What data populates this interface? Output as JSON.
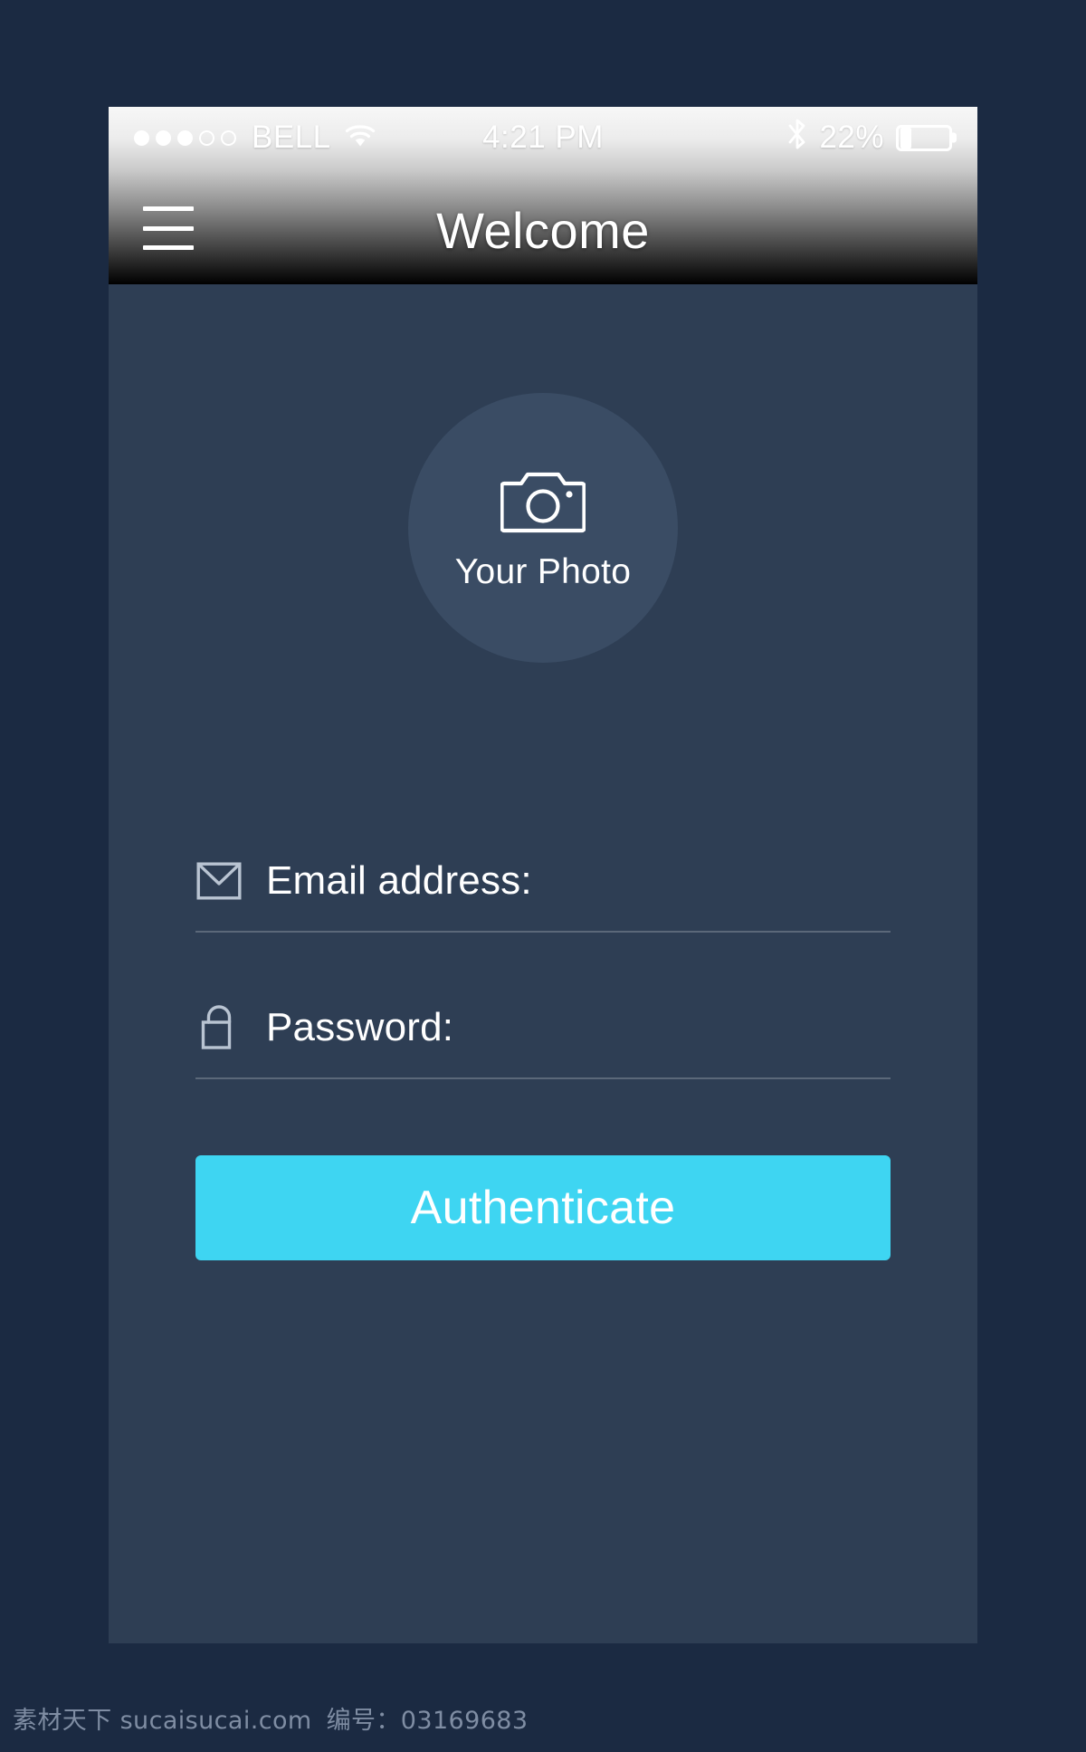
{
  "app": {
    "background_color": "#1b2a42",
    "screen_color": "#2e3e54",
    "accent_color": "#3ed5f2"
  },
  "status_bar": {
    "carrier": "BELL",
    "signal_dots_filled": 3,
    "signal_dots_total": 5,
    "wifi_icon": "wifi-icon",
    "time": "4:21 PM",
    "bluetooth_icon": "bluetooth-icon",
    "battery_percent_label": "22%",
    "battery_level": 22
  },
  "nav_bar": {
    "title": "Welcome",
    "menu_icon": "hamburger-menu-icon"
  },
  "avatar": {
    "icon": "camera-icon",
    "label": "Your Photo"
  },
  "form": {
    "fields": [
      {
        "icon": "envelope-icon",
        "label": "Email address:",
        "value": "",
        "placeholder": ""
      },
      {
        "icon": "lock-icon",
        "label": "Password:",
        "value": "",
        "placeholder": ""
      }
    ],
    "submit_label": "Authenticate"
  },
  "watermark": {
    "site_cn": "素材天下",
    "site_url": "sucaisucai.com",
    "id_label": "编号：",
    "id_value": "03169683"
  }
}
